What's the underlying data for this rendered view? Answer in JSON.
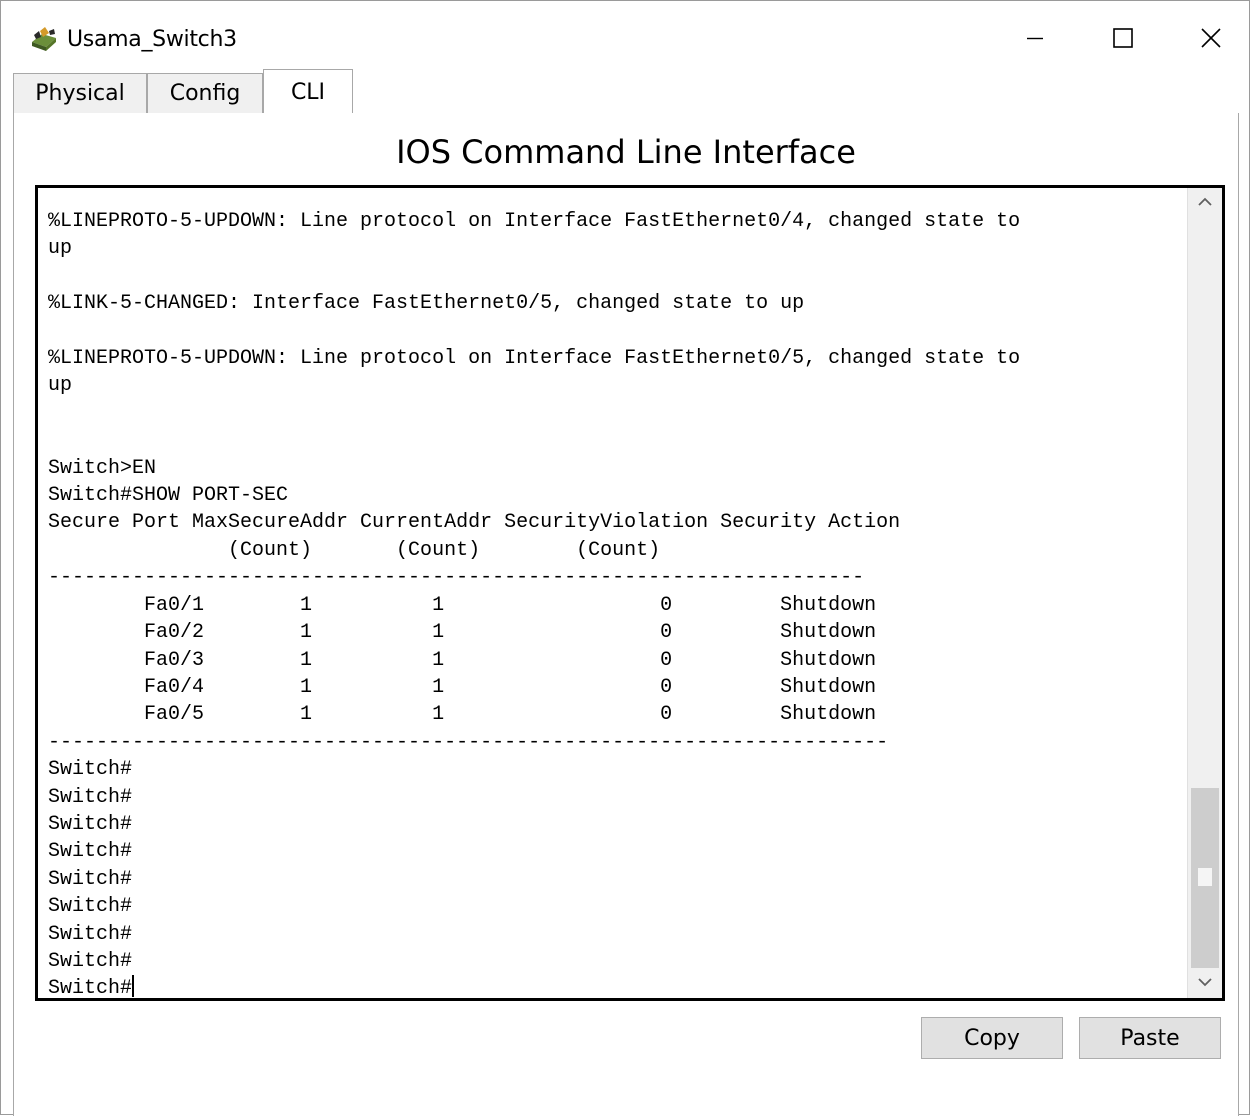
{
  "window": {
    "title": "Usama_Switch3"
  },
  "tabs": [
    {
      "label": "Physical"
    },
    {
      "label": "Config"
    },
    {
      "label": "CLI"
    }
  ],
  "active_tab": "CLI",
  "heading": "IOS Command Line Interface",
  "terminal": {
    "lines": [
      "%LINEPROTO-5-UPDOWN: Line protocol on Interface FastEthernet0/4, changed state to",
      "up",
      "",
      "%LINK-5-CHANGED: Interface FastEthernet0/5, changed state to up",
      "",
      "%LINEPROTO-5-UPDOWN: Line protocol on Interface FastEthernet0/5, changed state to",
      "up",
      "",
      "",
      "Switch>EN",
      "Switch#SHOW PORT-SEC",
      "Secure Port MaxSecureAddr CurrentAddr SecurityViolation Security Action",
      "               (Count)       (Count)        (Count)",
      "--------------------------------------------------------------------",
      "        Fa0/1        1          1                  0         Shutdown",
      "        Fa0/2        1          1                  0         Shutdown",
      "        Fa0/3        1          1                  0         Shutdown",
      "        Fa0/4        1          1                  0         Shutdown",
      "        Fa0/5        1          1                  0         Shutdown",
      "----------------------------------------------------------------------",
      "Switch#",
      "Switch#",
      "Switch#",
      "Switch#",
      "Switch#",
      "Switch#",
      "Switch#",
      "Switch#"
    ],
    "prompt": "Switch#"
  },
  "buttons": {
    "copy": "Copy",
    "paste": "Paste"
  },
  "window_controls": {
    "minimize_icon": "minimize-icon",
    "maximize_icon": "maximize-icon",
    "close_icon": "close-icon"
  }
}
